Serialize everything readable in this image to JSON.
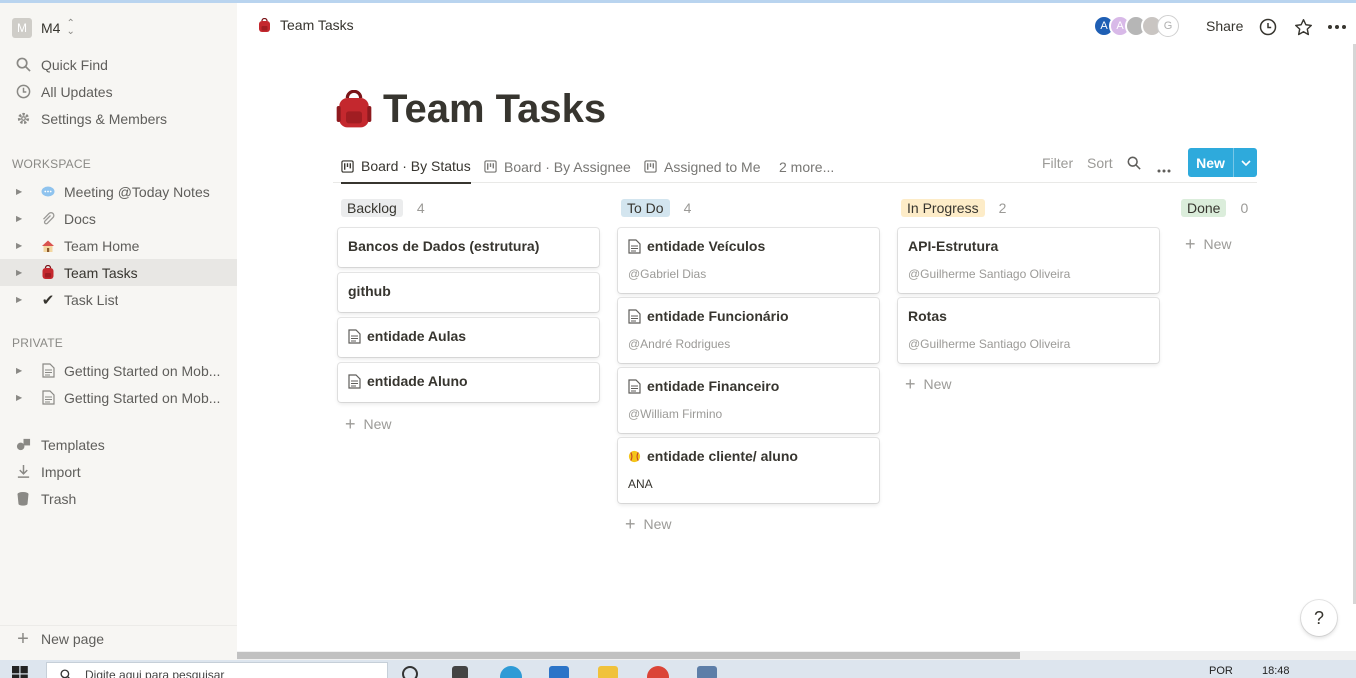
{
  "sidebar": {
    "workspace": {
      "badge": "M",
      "name": "M4"
    },
    "nav": [
      {
        "label": "Quick Find",
        "icon": "search-icon"
      },
      {
        "label": "All Updates",
        "icon": "clock-icon"
      },
      {
        "label": "Settings & Members",
        "icon": "gear-icon"
      }
    ],
    "workspace_section": "WORKSPACE",
    "workspace_pages": [
      {
        "label": "Meeting @Today Notes",
        "icon": "speech-bubble-icon"
      },
      {
        "label": "Docs",
        "icon": "paperclip-icon"
      },
      {
        "label": "Team Home",
        "icon": "house-icon"
      },
      {
        "label": "Team Tasks",
        "icon": "backpack-icon"
      },
      {
        "label": "Task List",
        "icon": "checkmark-icon"
      }
    ],
    "private_section": "PRIVATE",
    "private_pages": [
      {
        "label": "Getting Started on Mob...",
        "icon": "page-icon"
      },
      {
        "label": "Getting Started on Mob...",
        "icon": "page-icon"
      }
    ],
    "footer": [
      {
        "label": "Templates",
        "icon": "shapes-icon"
      },
      {
        "label": "Import",
        "icon": "download-icon"
      },
      {
        "label": "Trash",
        "icon": "trash-icon"
      }
    ],
    "new_page": "New page"
  },
  "header": {
    "breadcrumb": "Team Tasks",
    "share": "Share",
    "avatars": [
      "A",
      "A",
      "",
      "",
      "G"
    ]
  },
  "page": {
    "title": "Team Tasks"
  },
  "views": {
    "tabs": [
      "Board · By Status",
      "Board · By Assignee",
      "Assigned to Me"
    ],
    "more": "2 more...",
    "filter": "Filter",
    "sort": "Sort",
    "new_button": "New"
  },
  "board": {
    "new_label": "New",
    "columns": [
      {
        "name": "Backlog",
        "count": "4",
        "color": "#ebeced",
        "cards": [
          {
            "title": "Bancos de Dados (estrutura)",
            "icon": "",
            "subtitle": ""
          },
          {
            "title": "github",
            "icon": "",
            "subtitle": ""
          },
          {
            "title": "entidade Aulas",
            "icon": "page-icon",
            "subtitle": ""
          },
          {
            "title": "entidade Aluno",
            "icon": "page-icon",
            "subtitle": ""
          }
        ]
      },
      {
        "name": "To Do",
        "count": "4",
        "color": "#d3e5ef",
        "cards": [
          {
            "title": "entidade Veículos",
            "icon": "page-icon",
            "subtitle": "@Gabriel Dias"
          },
          {
            "title": "entidade Funcionário",
            "icon": "page-icon",
            "subtitle": "@André Rodrigues"
          },
          {
            "title": "entidade Financeiro",
            "icon": "page-icon",
            "subtitle": "@William Firmino"
          },
          {
            "title": "entidade cliente/ aluno",
            "icon": "softball-icon",
            "subtitle": "ANA"
          }
        ]
      },
      {
        "name": "In Progress",
        "count": "2",
        "color": "#fdecc8",
        "cards": [
          {
            "title": "API-Estrutura",
            "icon": "",
            "subtitle": "@Guilherme Santiago Oliveira"
          },
          {
            "title": "Rotas",
            "icon": "",
            "subtitle": "@Guilherme Santiago Oliveira"
          }
        ]
      },
      {
        "name": "Done",
        "count": "0",
        "color": "#dbeddb",
        "cards": []
      }
    ]
  },
  "help": "?",
  "taskbar": {
    "search_placeholder": "Digite aqui para pesquisar",
    "lang": "POR",
    "time": "18:48"
  }
}
